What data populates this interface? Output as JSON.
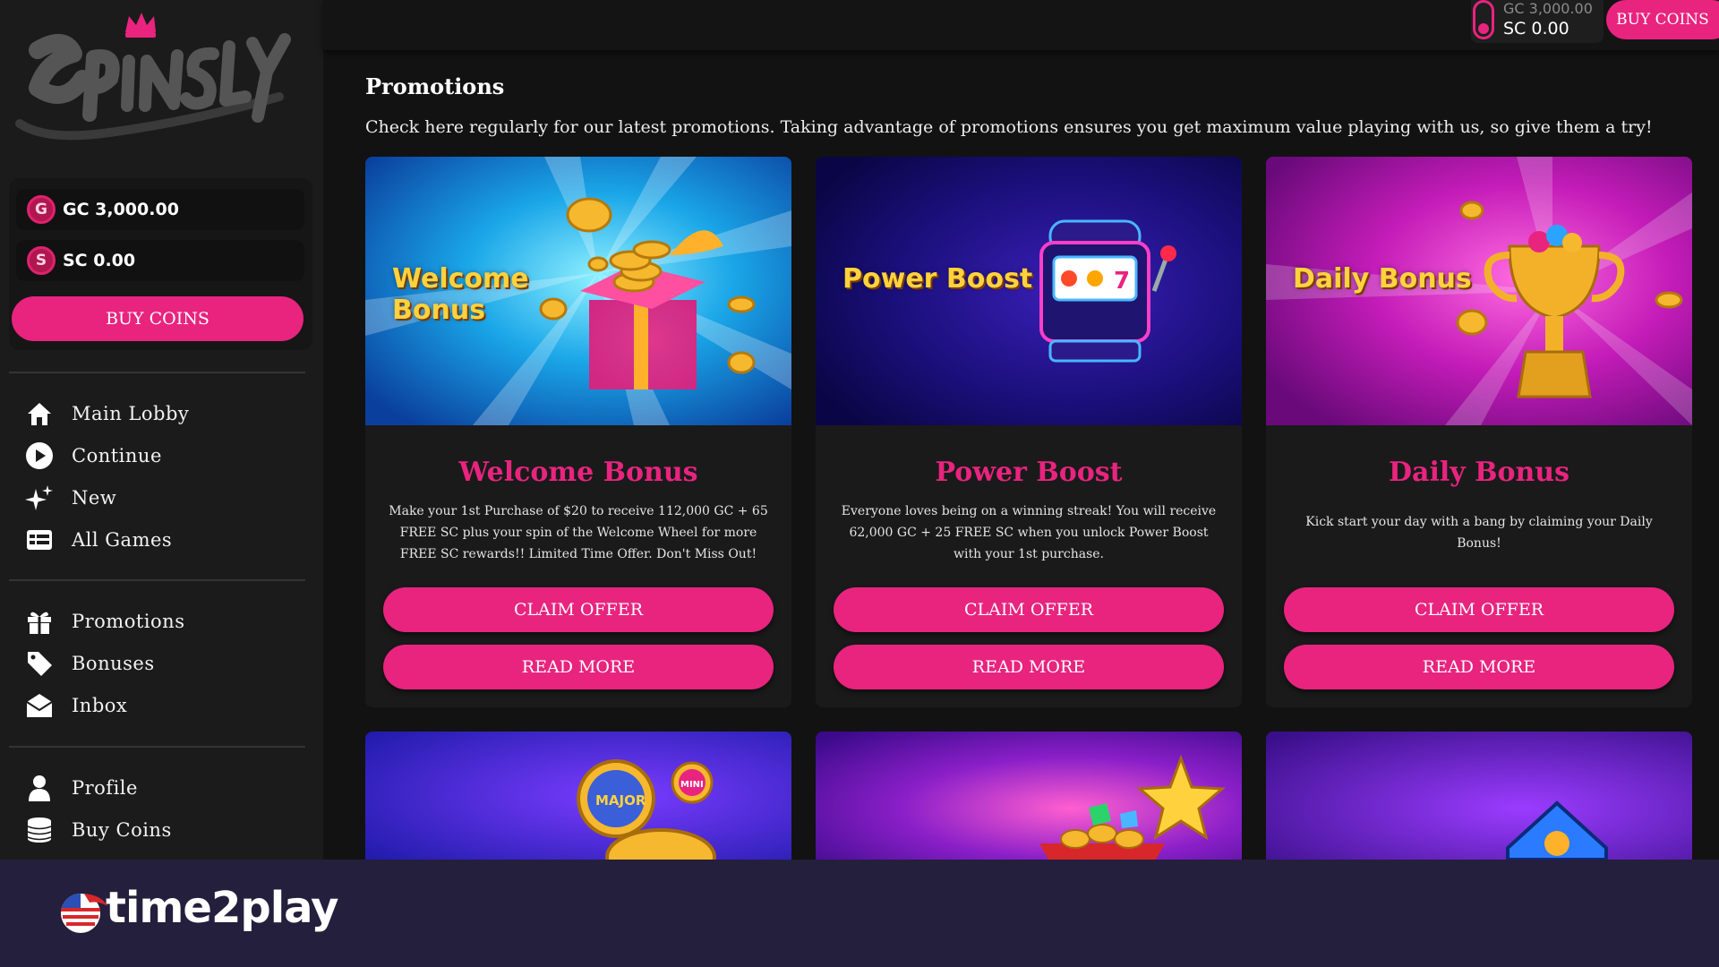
{
  "brand": {
    "name": "Spinsly"
  },
  "wallet": {
    "gc_badge": "G",
    "sc_badge": "S",
    "gc_value": "GC 3,000.00",
    "sc_value": "SC 0.00",
    "buy_label": "BUY COINS"
  },
  "topbar": {
    "gc_value": "GC 3,000.00",
    "sc_value": "SC 0.00",
    "buy_label": "BUY COINS"
  },
  "nav": {
    "group1": [
      {
        "label": "Main Lobby",
        "icon": "home-icon"
      },
      {
        "label": "Continue",
        "icon": "play-icon"
      },
      {
        "label": "New",
        "icon": "sparkles-icon"
      },
      {
        "label": "All Games",
        "icon": "grid-table-icon"
      }
    ],
    "group2": [
      {
        "label": "Promotions",
        "icon": "gift-icon"
      },
      {
        "label": "Bonuses",
        "icon": "tag-icon"
      },
      {
        "label": "Inbox",
        "icon": "envelope-icon"
      }
    ],
    "group3": [
      {
        "label": "Profile",
        "icon": "user-icon"
      },
      {
        "label": "Buy Coins",
        "icon": "coin-stack-icon"
      }
    ]
  },
  "main": {
    "title": "Promotions",
    "intro": "Check here regularly for our latest promotions. Taking advantage of promotions ensures you get maximum value playing with us, so give them a try!",
    "cards": [
      {
        "banner_line1": "Welcome",
        "banner_line2": "Bonus",
        "title": "Welcome Bonus",
        "description": "Make your 1st Purchase of $20 to receive 112,000 GC + 65 FREE SC plus your spin of the Welcome Wheel for more FREE SC rewards!! Limited Time Offer. Don't Miss Out!",
        "claim_label": "CLAIM OFFER",
        "read_label": "READ MORE"
      },
      {
        "banner_line1": "Power Boost",
        "title": "Power Boost",
        "description": "Everyone loves being on a winning streak! You will receive 62,000 GC + 25 FREE SC when you unlock Power Boost with your 1st purchase.",
        "claim_label": "CLAIM OFFER",
        "read_label": "READ MORE"
      },
      {
        "banner_line1": "Daily Bonus",
        "title": "Daily Bonus",
        "description": "Kick start your day with a bang by claiming your Daily Bonus!",
        "claim_label": "CLAIM OFFER",
        "read_label": "READ MORE"
      }
    ],
    "row2_badges": [
      "MAJOR",
      "MINI"
    ]
  },
  "footer": {
    "brand": "time2play"
  },
  "colors": {
    "accent": "#e8247f",
    "background": "#121212",
    "sidebar": "#1b1b1b",
    "card": "#1a1a1a",
    "footer": "#241f3c",
    "banner_text": "#ffd23d"
  }
}
